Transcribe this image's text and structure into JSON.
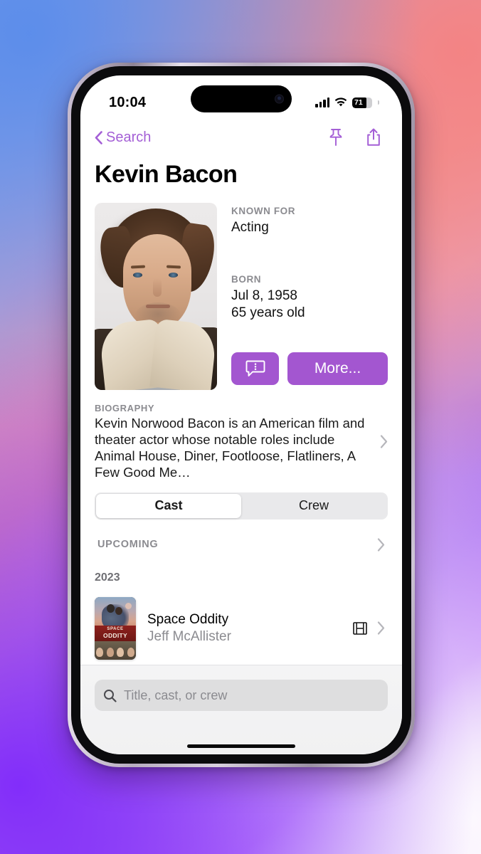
{
  "statusbar": {
    "time": "10:04",
    "battery_percent": "71",
    "signal_icon": "cellular-bars-icon",
    "wifi_icon": "wifi-icon",
    "battery_icon": "battery-icon"
  },
  "navbar": {
    "back_label": "Search",
    "back_icon": "chevron-left-icon",
    "pin_icon": "pin-icon",
    "share_icon": "share-icon"
  },
  "person": {
    "name": "Kevin Bacon",
    "portrait_alt": "kevin-bacon-portrait",
    "known_for_label": "KNOWN FOR",
    "known_for_value": "Acting",
    "born_label": "BORN",
    "born_date": "Jul 8, 1958",
    "age": "65 years old"
  },
  "actions": {
    "quote_icon": "speech-bubble-icon",
    "more_label": "More..."
  },
  "biography": {
    "label": "BIOGRAPHY",
    "text": "Kevin Norwood Bacon is an American film and theater actor whose notable roles include Animal House, Diner, Footloose, Flatliners, A Few Good Me…",
    "chevron_icon": "chevron-right-icon"
  },
  "segmented": {
    "options": [
      "Cast",
      "Crew"
    ],
    "selected": "Cast"
  },
  "sections": [
    {
      "header": "UPCOMING",
      "chevron_icon": "chevron-right-icon",
      "year": "2023",
      "items": [
        {
          "title": "Space Oddity",
          "role": "Jeff McAllister",
          "media_icon": "film-strip-icon",
          "chevron_icon": "chevron-right-icon",
          "poster_line1": "SPACE",
          "poster_line2": "ODDITY"
        }
      ]
    }
  ],
  "search": {
    "placeholder": "Title, cast, or crew",
    "icon": "search-icon"
  },
  "colors": {
    "accent_purple": "#a356d0",
    "nav_purple": "#a45fd6",
    "secondary_text": "#8b8b90"
  }
}
